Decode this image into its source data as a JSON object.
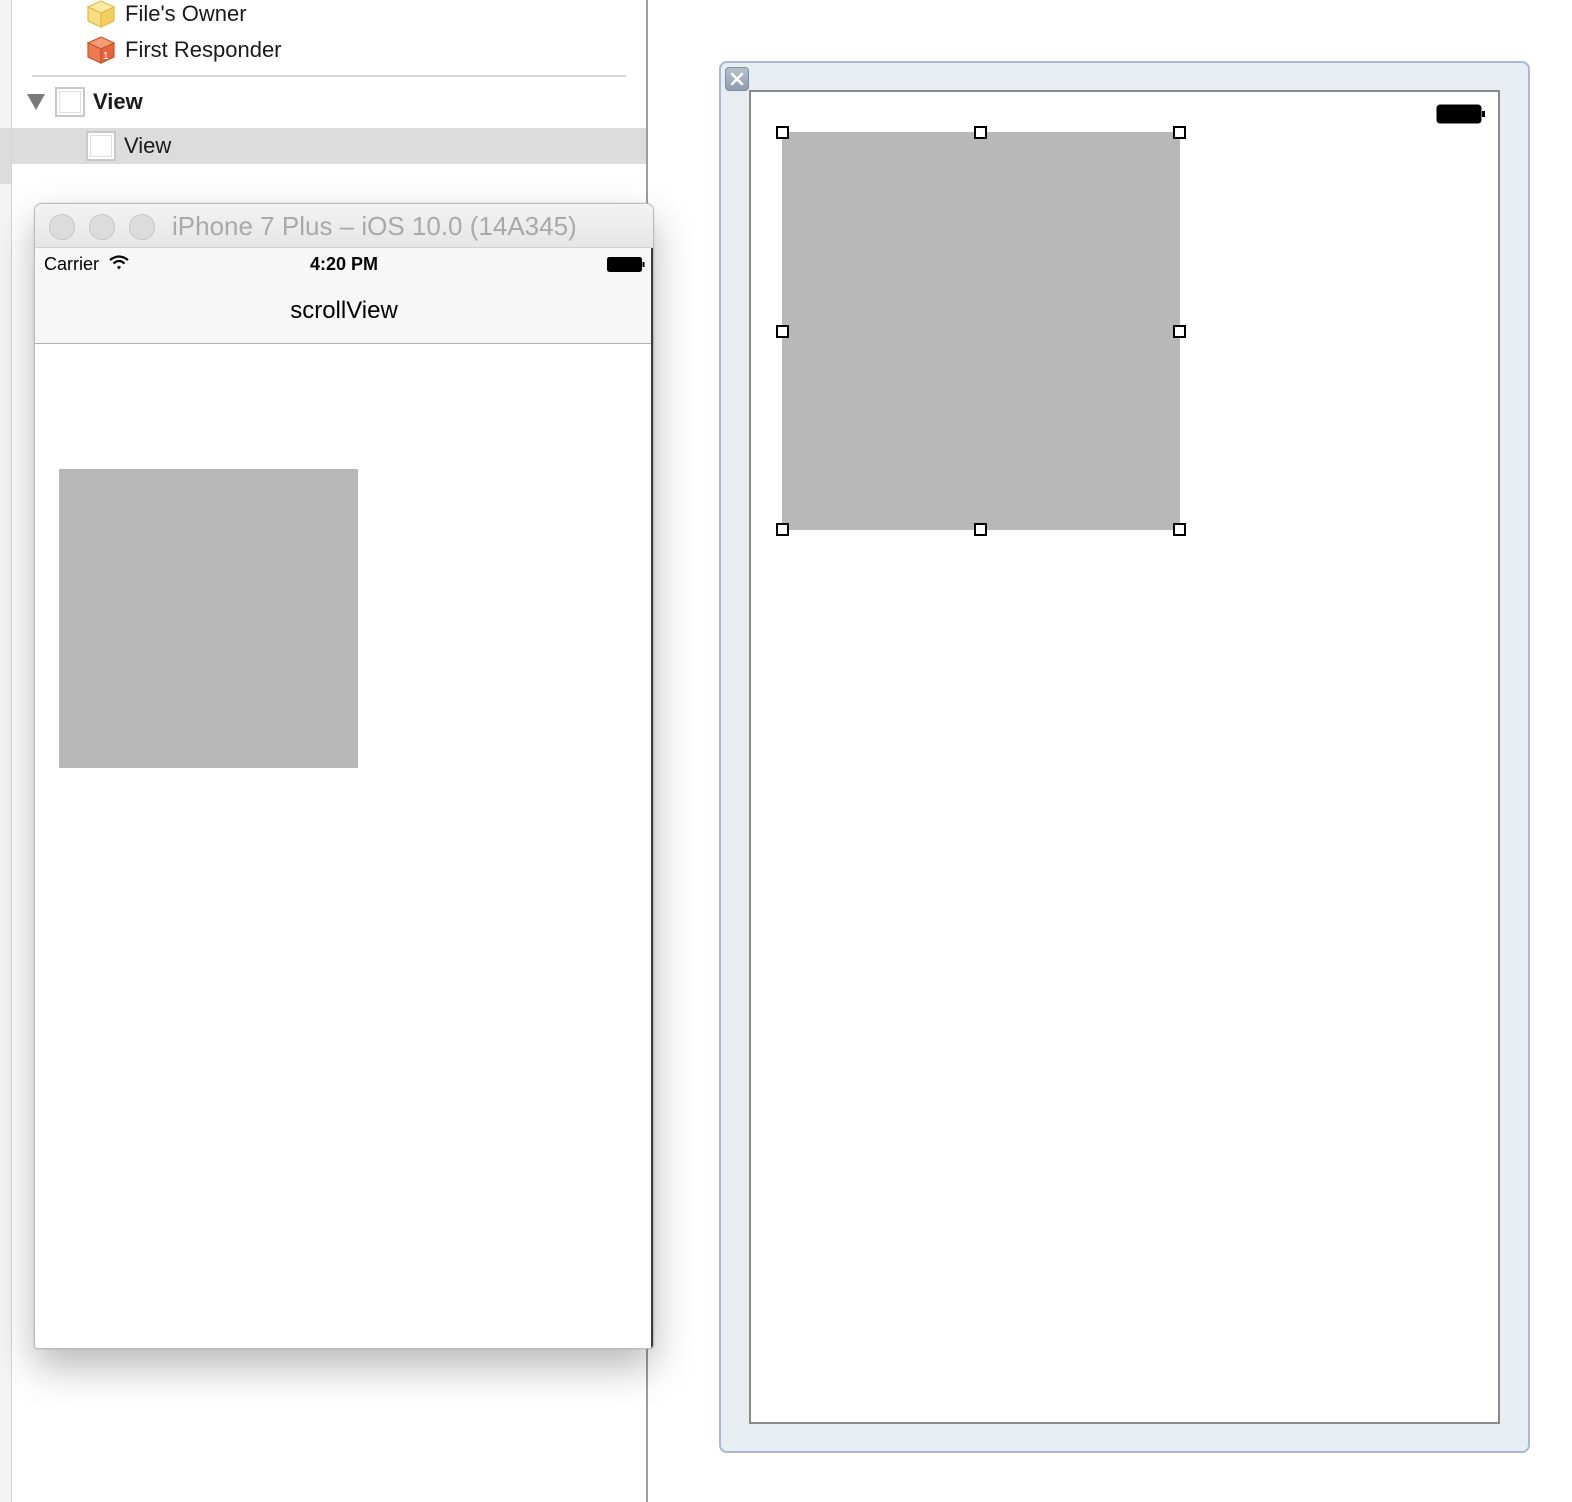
{
  "outline": {
    "items": [
      {
        "label": "File's Owner",
        "icon": "files-owner-cube-icon"
      },
      {
        "label": "First Responder",
        "icon": "first-responder-cube-icon"
      },
      {
        "label": "View",
        "icon": "view-icon",
        "expanded": true
      },
      {
        "label": "View",
        "icon": "view-icon",
        "selected": true
      }
    ]
  },
  "simulator": {
    "title": "iPhone 7 Plus – iOS 10.0 (14A345)",
    "status_bar": {
      "carrier": "Carrier",
      "time": "4:20 PM"
    },
    "nav_title": "scrollView"
  },
  "colors": {
    "gray_box": "#b8b8b8",
    "selection": "#dcdcdc",
    "ib_frame_border": "#a9b8d4",
    "files_owner_icon": "#f5d978",
    "first_responder_icon": "#e8734a"
  }
}
